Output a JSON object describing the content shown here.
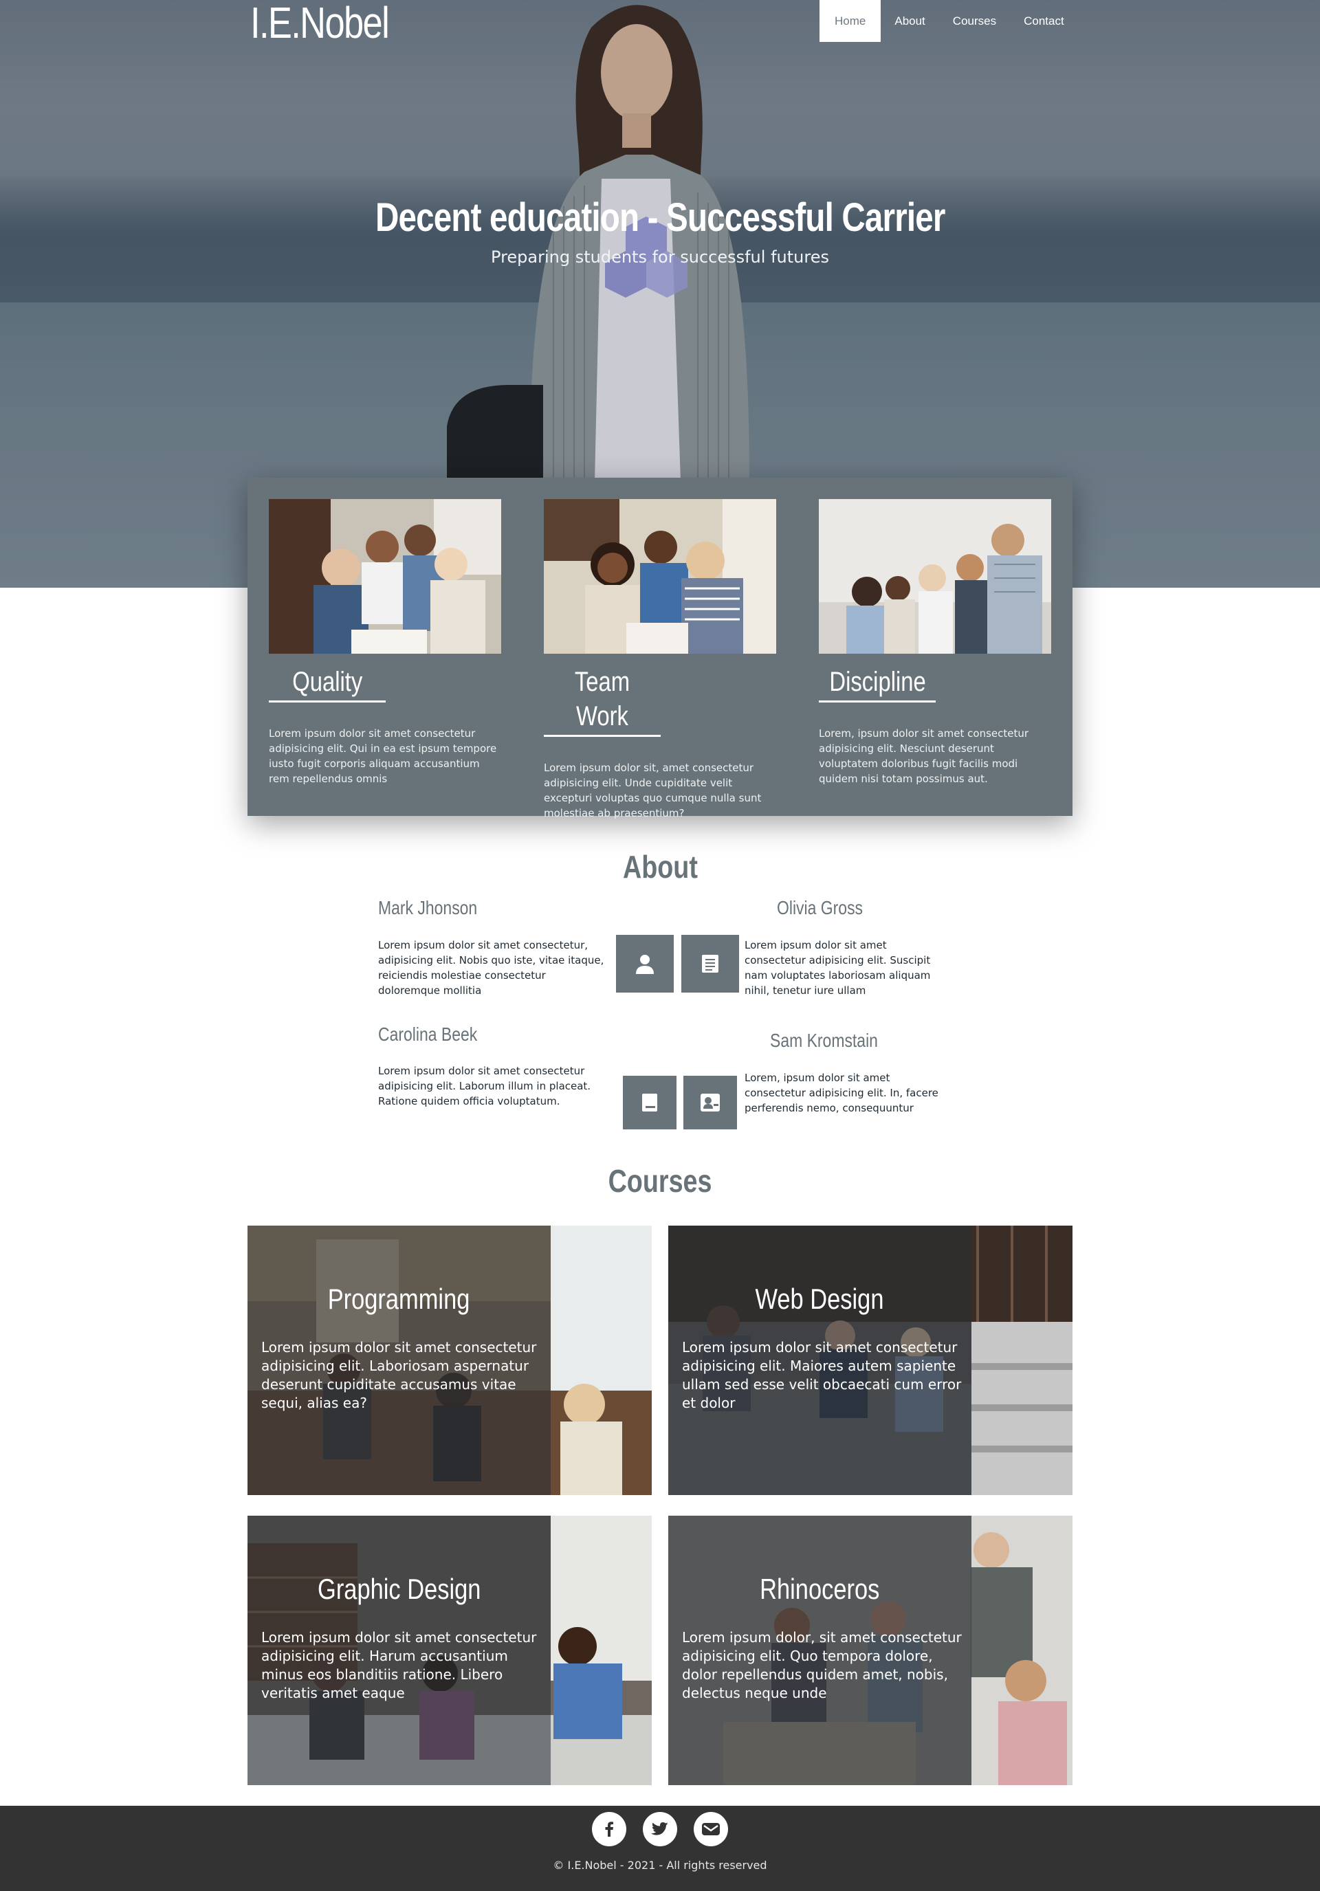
{
  "header": {
    "brand": "I.E.Nobel",
    "nav": [
      {
        "label": "Home",
        "active": true
      },
      {
        "label": "About",
        "active": false
      },
      {
        "label": "Courses",
        "active": false
      },
      {
        "label": "Contact",
        "active": false
      }
    ]
  },
  "hero": {
    "title": "Decent education - Successful Carrier",
    "subtitle": "Preparing students for successful futures"
  },
  "features": [
    {
      "title": "Quality",
      "text": "Lorem ipsum dolor sit amet consectetur adipisicing elit. Qui in ea est ipsum tempore iusto fugit corporis aliquam accusantium rem repellendus omnis"
    },
    {
      "title": "Team Work",
      "text": "Lorem ipsum dolor sit, amet consectetur adipisicing elit. Unde cupiditate velit excepturi voluptas quo cumque nulla sunt molestiae ab praesentium?"
    },
    {
      "title": "Discipline",
      "text": "Lorem, ipsum dolor sit amet consectetur adipisicing elit. Nesciunt deserunt voluptatem doloribus fugit facilis modi quidem nisi totam possimus aut."
    }
  ],
  "about": {
    "title": "About",
    "members": [
      {
        "name": "Mark Jhonson",
        "text": "Lorem ipsum dolor sit amet consectetur, adipisicing elit. Nobis quo iste, vitae itaque, reiciendis molestiae consectetur doloremque mollitia",
        "icon": "user-icon"
      },
      {
        "name": "Olivia Gross",
        "text": "Lorem ipsum dolor sit amet consectetur adipisicing elit. Suscipit nam voluptates laboriosam aliquam nihil, tenetur iure ullam",
        "icon": "document-icon"
      },
      {
        "name": "Carolina Beek",
        "text": "Lorem ipsum dolor sit amet consectetur adipisicing elit. Laborum illum in placeat. Ratione quidem officia voluptatum.",
        "icon": "book-icon"
      },
      {
        "name": "Sam Kromstain",
        "text": "Lorem, ipsum dolor sit amet consectetur adipisicing elit. In, facere perferendis nemo, consequuntur",
        "icon": "contact-card-icon"
      }
    ]
  },
  "courses": {
    "title": "Courses",
    "items": [
      {
        "title": "Programming",
        "text": "Lorem ipsum dolor sit amet consectetur adipisicing elit. Laboriosam aspernatur deserunt cupiditate accusamus vitae sequi, alias ea?"
      },
      {
        "title": "Web Design",
        "text": "Lorem ipsum dolor sit amet consectetur adipisicing elit. Maiores autem sapiente ullam sed esse velit obcaecati cum error et dolor"
      },
      {
        "title": "Graphic Design",
        "text": "Lorem ipsum dolor sit amet consectetur adipisicing elit. Harum accusantium minus eos blanditiis ratione. Libero veritatis amet eaque"
      },
      {
        "title": "Rhinoceros",
        "text": "Lorem ipsum dolor, sit amet consectetur adipisicing elit. Quo tempora dolore, dolor repellendus quidem amet, nobis, delectus neque unde"
      }
    ]
  },
  "footer": {
    "social": [
      "facebook-icon",
      "twitter-icon",
      "email-icon"
    ],
    "copyright": "© I.E.Nobel - 2021 - All rights reserved"
  },
  "colors": {
    "primary": "#677378",
    "footer": "#333333",
    "text": "#1f2a33",
    "white": "#ffffff"
  }
}
